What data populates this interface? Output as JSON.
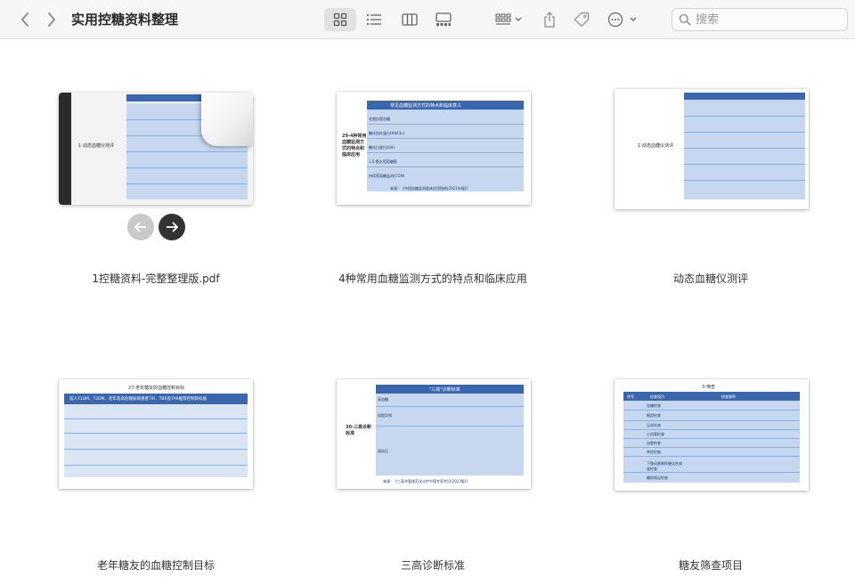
{
  "window": {
    "title": "实用控糖资料整理"
  },
  "toolbar": {
    "back_label": "back",
    "forward_label": "forward",
    "search_placeholder": "搜索"
  },
  "files": [
    {
      "name": "1控糖资料-完整整理版.pdf",
      "preview_title": "1-动态血糖仪测评"
    },
    {
      "name": "4种常用血糖监测方式的特点和临床应用",
      "preview_title": "常见血糖监测方式的特点和临床意义",
      "preview_side": "29-4种常用血糖监测方式的特点和临床应用",
      "preview_rows": [
        "毛细血管血糖",
        "糖化血红蛋白(HbA1c)",
        "糖化白蛋白(GA)",
        "1,5-脱水葡萄糖醇",
        "持续葡萄糖监测(CGM)"
      ],
      "preview_footer": "来源：《中国血糖监测临床应用指南(2021年版)》"
    },
    {
      "name": "动态血糖仪测评",
      "preview_title": "1-动态血糖仪测评"
    },
    {
      "name": "老年糖友的血糖控制目标",
      "preview_title": "27-老年糖友的血糖控制目标",
      "preview_banner": "成人T1DM、T2DM、老年及高危糖尿病患者TIR、TBR及TAR推荐控制目标值"
    },
    {
      "name": "三高诊断标准",
      "preview_title": "\"三高\"诊断标准",
      "preview_side": "30-三高诊断标准",
      "preview_rows": [
        "高血糖",
        "血脂异常",
        "高血压"
      ],
      "preview_footer": "来源：《三高共管规范化诊疗中国专家共识(2023版)》"
    },
    {
      "name": "糖友筛查项目",
      "preview_title": "3-筛查",
      "preview_headers": [
        "序号",
        "检查项目",
        "检查频率"
      ],
      "preview_rows": [
        "血糖检查",
        "眼部检查",
        "足部检查",
        "心血管检查",
        "血脂检查",
        "神经检查",
        "下肢动脉粥样硬化性病变检查",
        "糖尿病足检查"
      ]
    }
  ],
  "colors": {
    "toolbar_bg": "#f6f6f6",
    "table_header": "#3a66ad",
    "table_body": "#c6d7ef"
  }
}
